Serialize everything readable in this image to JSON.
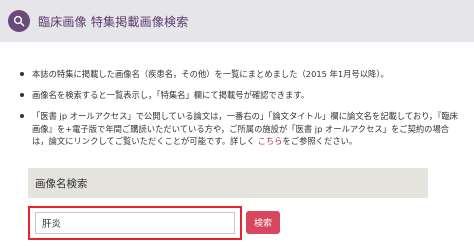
{
  "header": {
    "title": "臨床画像 特集掲載画像検索",
    "icon": "search-icon"
  },
  "notes": [
    {
      "text": "本誌の特集に掲載した画像名（疾患名，その他）を一覧にまとめました（2015 年1月号以降）。"
    },
    {
      "text": "画像名を検索すると一覧表示し，「特集名」欄にて掲載号が確認できます。"
    },
    {
      "text": "「医書 jp オールアクセス」で公開している論文は，一番右の」「論文タイトル」欄に論文名を記載しており，『臨床画像』を+電子版で年間ご購読いただいている方や，ご所属の施設が「医書 jp オールアクセス」をご契約の場合は，論文にリンクしてご覧いただくことが可能です。詳しく ",
      "link": "こちら",
      "suffix": "をご参照ください。"
    }
  ],
  "search_section": {
    "title": "画像名検索",
    "input_value": "肝炎",
    "button_label": "検索"
  },
  "colors": {
    "accent": "#6a4a7a",
    "button": "#d9475f",
    "highlight_border": "#e8232b"
  }
}
